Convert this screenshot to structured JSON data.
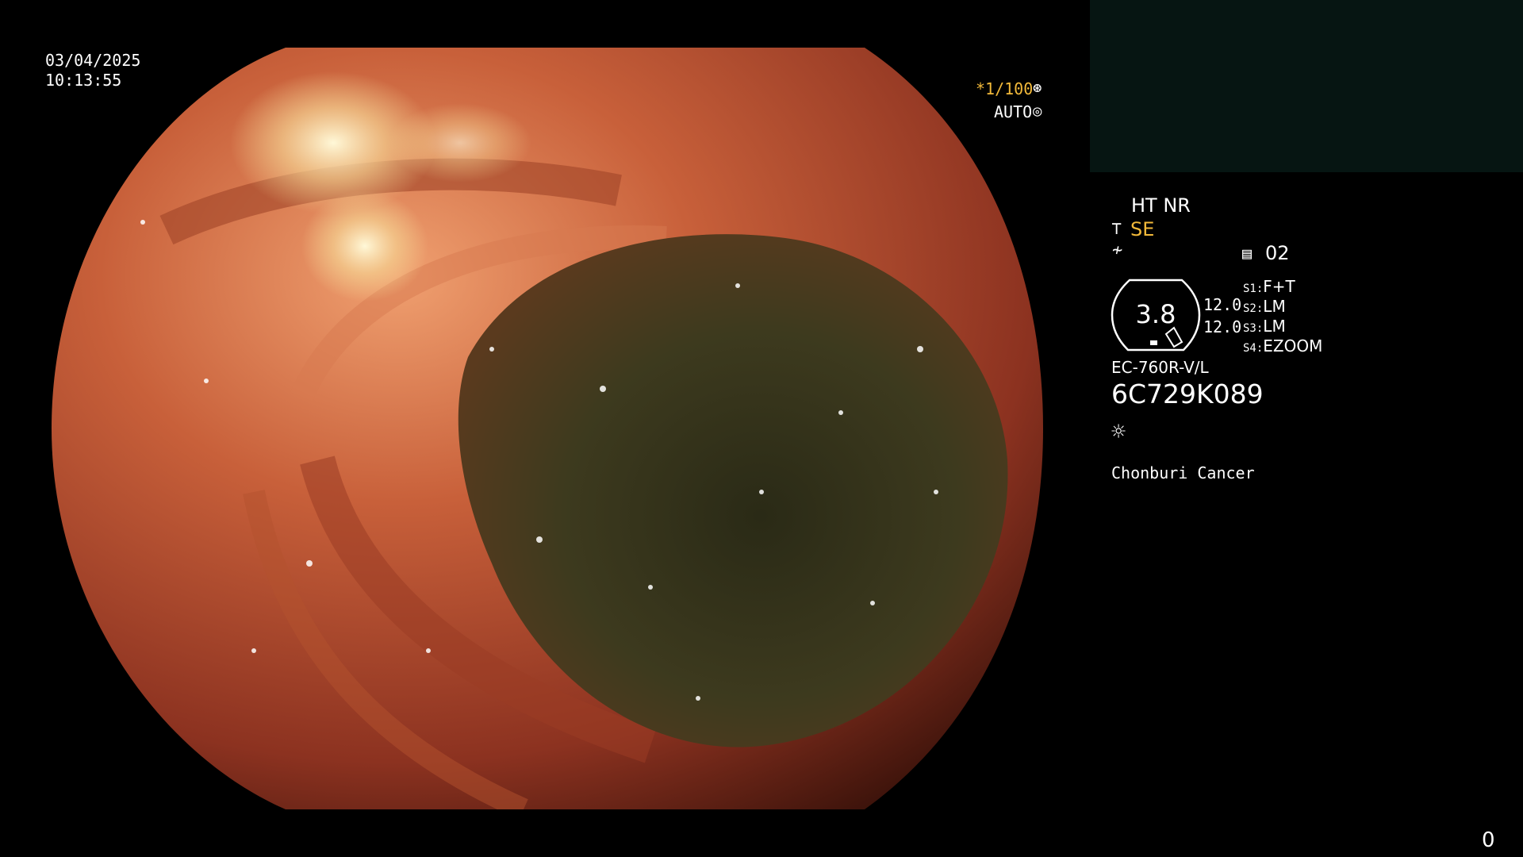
{
  "overlay": {
    "date": "03/04/2025",
    "time": "10:13:55",
    "shutter_speed": "*1/100",
    "exposure_mode": "AUTO",
    "processing_modes": "HT NR",
    "se_label": "SE",
    "memo_number": "02",
    "zoom_value": "3.8",
    "enhancement_1": "12.0",
    "enhancement_2": "12.0",
    "switches": [
      {
        "key": "S1",
        "value": "F+T"
      },
      {
        "key": "S2",
        "value": "LM"
      },
      {
        "key": "S3",
        "value": "LM"
      },
      {
        "key": "S4",
        "value": "EZOOM"
      }
    ],
    "scope_model": "EC-760R-V/L",
    "scope_serial": "6C729K089",
    "institution": "Chonburi Cancer",
    "frame_count": "0"
  },
  "icons": {
    "shutter": "shutter-icon",
    "exposure": "exposure-icon",
    "se": "structure-enhancement-icon",
    "freeze": "freeze-icon",
    "memo": "memo-icon",
    "light": "light-source-icon"
  },
  "colors": {
    "accent_text": "#f2b93a",
    "thumbnail_panel": "#061512",
    "background": "#000000"
  }
}
